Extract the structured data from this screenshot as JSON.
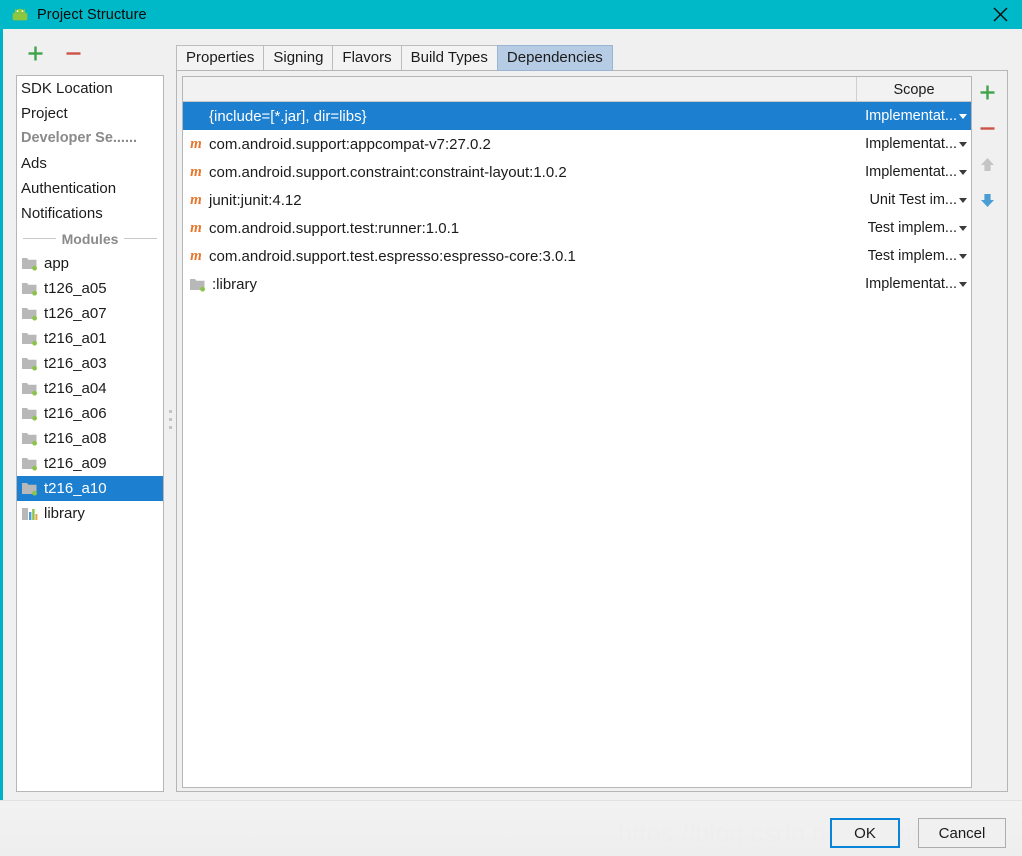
{
  "window": {
    "title": "Project Structure",
    "app_icon": "android-robot-icon",
    "close_icon": "close-icon",
    "titlebar_color": "#00b9c8"
  },
  "left_toolbar": {
    "add_label": "+",
    "remove_label": "−",
    "add_icon": "plus-icon",
    "remove_icon": "minus-icon",
    "add_color": "#3fa34a",
    "remove_color": "#cc5247"
  },
  "sidebar": {
    "items": [
      {
        "label": "SDK Location",
        "type": "item"
      },
      {
        "label": "Project",
        "type": "item"
      },
      {
        "label": "Developer Se......",
        "type": "group"
      },
      {
        "label": "Ads",
        "type": "item"
      },
      {
        "label": "Authentication",
        "type": "item"
      },
      {
        "label": "Notifications",
        "type": "item"
      }
    ],
    "modules_header": "Modules",
    "modules": [
      {
        "label": "app",
        "icon": "module-folder-icon",
        "selected": false
      },
      {
        "label": "t126_a05",
        "icon": "module-folder-icon",
        "selected": false
      },
      {
        "label": "t126_a07",
        "icon": "module-folder-icon",
        "selected": false
      },
      {
        "label": "t216_a01",
        "icon": "module-folder-icon",
        "selected": false
      },
      {
        "label": "t216_a03",
        "icon": "module-folder-icon",
        "selected": false
      },
      {
        "label": "t216_a04",
        "icon": "module-folder-icon",
        "selected": false
      },
      {
        "label": "t216_a06",
        "icon": "module-folder-icon",
        "selected": false
      },
      {
        "label": "t216_a08",
        "icon": "module-folder-icon",
        "selected": false
      },
      {
        "label": "t216_a09",
        "icon": "module-folder-icon",
        "selected": false
      },
      {
        "label": "t216_a10",
        "icon": "module-folder-icon",
        "selected": true
      },
      {
        "label": "library",
        "icon": "library-icon",
        "selected": false
      }
    ],
    "selection_color": "#1d7fd0"
  },
  "tabs": [
    {
      "label": "Properties",
      "active": false
    },
    {
      "label": "Signing",
      "active": false
    },
    {
      "label": "Flavors",
      "active": false
    },
    {
      "label": "Build Types",
      "active": false
    },
    {
      "label": "Dependencies",
      "active": true
    }
  ],
  "table": {
    "columns": [
      {
        "label": "",
        "key": "name"
      },
      {
        "label": "Scope",
        "key": "scope"
      }
    ],
    "rows": [
      {
        "name": "{include=[*.jar], dir=libs}",
        "scope": "Implementat...",
        "icon": "none",
        "selected": true
      },
      {
        "name": "com.android.support:appcompat-v7:27.0.2",
        "scope": "Implementat...",
        "icon": "maven-icon",
        "selected": false
      },
      {
        "name": "com.android.support.constraint:constraint-layout:1.0.2",
        "scope": "Implementat...",
        "icon": "maven-icon",
        "selected": false
      },
      {
        "name": "junit:junit:4.12",
        "scope": "Unit Test im...",
        "icon": "maven-icon",
        "selected": false
      },
      {
        "name": "com.android.support.test:runner:1.0.1",
        "scope": "Test implem...",
        "icon": "maven-icon",
        "selected": false
      },
      {
        "name": "com.android.support.test.espresso:espresso-core:3.0.1",
        "scope": "Test implem...",
        "icon": "maven-icon",
        "selected": false
      },
      {
        "name": ":library",
        "scope": "Implementat...",
        "icon": "module-folder-icon",
        "selected": false
      }
    ]
  },
  "table_toolbar": {
    "add_icon": "plus-icon",
    "remove_icon": "minus-icon",
    "move_up_icon": "arrow-up-icon",
    "move_down_icon": "arrow-down-icon",
    "add_color": "#3fa34a",
    "remove_color": "#cc5247",
    "up_color": "#c4c4c4",
    "down_color": "#4a9ed4"
  },
  "footer": {
    "ok_label": "OK",
    "cancel_label": "Cancel",
    "watermark": "https://blog.csdn.net/ahong_4020",
    "focus_color": "#0a84d8"
  }
}
